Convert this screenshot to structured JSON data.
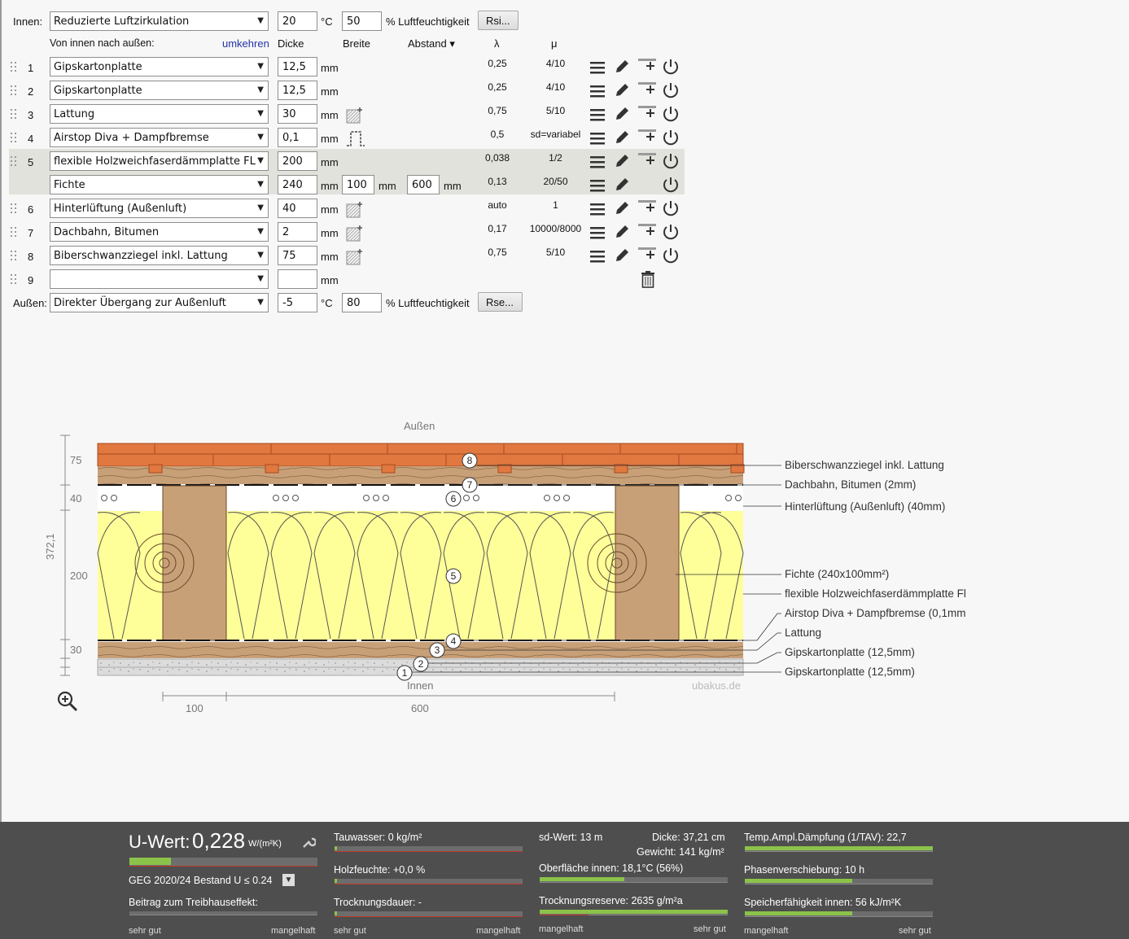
{
  "inside": {
    "label": "Innen:",
    "select": "Reduzierte Luftzirkulation",
    "temp": "20",
    "temp_unit": "°C",
    "humidity": "50",
    "humidity_unit": "% Luftfeuchtigkeit",
    "button": "Rsi..."
  },
  "outside": {
    "label": "Außen:",
    "select": "Direkter Übergang zur Außenluft",
    "temp": "-5",
    "temp_unit": "°C",
    "humidity": "80",
    "humidity_unit": "% Luftfeuchtigkeit",
    "button": "Rse..."
  },
  "headers": {
    "direction": "Von innen nach außen:",
    "reverse": "umkehren",
    "thickness": "Dicke",
    "width": "Breite",
    "spacing": "Abstand ▾",
    "lambda": "λ",
    "mu": "μ"
  },
  "layers": [
    {
      "num": "1",
      "name": "Gipskartonplatte",
      "thickness": "12,5",
      "unit": "mm",
      "lambda": "0,25",
      "mu": "4/10"
    },
    {
      "num": "2",
      "name": "Gipskartonplatte",
      "thickness": "12,5",
      "unit": "mm",
      "lambda": "0,25",
      "mu": "4/10"
    },
    {
      "num": "3",
      "name": "Lattung",
      "thickness": "30",
      "unit": "mm",
      "lambda": "0,75",
      "mu": "5/10"
    },
    {
      "num": "4",
      "name": "Airstop Diva + Dampfbremse",
      "thickness": "0,1",
      "unit": "mm",
      "lambda": "0,5",
      "mu": "sd=variabel"
    },
    {
      "num": "5",
      "name": "flexible Holzweichfaserdämmplatte FL",
      "thickness": "200",
      "unit": "mm",
      "lambda": "0,038",
      "mu": "1/2"
    },
    {
      "num": "",
      "name": "Fichte",
      "thickness": "240",
      "unit": "mm",
      "width": "100",
      "width_unit": "mm",
      "spacing": "600",
      "spacing_unit": "mm",
      "lambda": "0,13",
      "mu": "20/50"
    },
    {
      "num": "6",
      "name": "Hinterlüftung (Außenluft)",
      "thickness": "40",
      "unit": "mm",
      "lambda": "auto",
      "mu": "1"
    },
    {
      "num": "7",
      "name": "Dachbahn, Bitumen",
      "thickness": "2",
      "unit": "mm",
      "lambda": "0,17",
      "mu": "10000/8000"
    },
    {
      "num": "8",
      "name": "Biberschwanzziegel inkl. Lattung",
      "thickness": "75",
      "unit": "mm",
      "lambda": "0,75",
      "mu": "5/10"
    },
    {
      "num": "9",
      "name": "",
      "thickness": "",
      "unit": "mm",
      "lambda": "",
      "mu": ""
    }
  ],
  "diagram": {
    "top_label": "Außen",
    "bottom_label": "Innen",
    "watermark": "ubakus.de",
    "total_thickness": "372,1",
    "dims": [
      "75",
      "40",
      "200",
      "30"
    ],
    "bottom_dims": [
      "100",
      "600"
    ],
    "markers": [
      "1",
      "2",
      "3",
      "4",
      "5",
      "6",
      "7",
      "8"
    ],
    "labels": [
      "Biberschwanzziegel inkl. Lattung",
      "Dachbahn, Bitumen (2mm)",
      "Hinterlüftung (Außenluft) (40mm)",
      "Fichte (240x100mm²)",
      "flexible Holzweichfaserdämmplatte Fl",
      "Airstop Diva + Dampfbremse (0,1mm",
      "Lattung",
      "Gipskartonplatte (12,5mm)",
      "Gipskartonplatte (12,5mm)"
    ]
  },
  "results": {
    "uwert_label": "U-Wert:",
    "uwert_value": "0,228",
    "uwert_unit": "W/(m²K)",
    "geg": "GEG 2020/24 Bestand U ≤ 0.24",
    "treibhaus": "Beitrag zum Treibhauseffekt:",
    "tauwasser": "Tauwasser: 0 kg/m²",
    "holzfeuchte": "Holzfeuchte: +0,0 %",
    "trocknungsdauer": "Trocknungsdauer: -",
    "sdwert": "sd-Wert: 13 m",
    "dicke": "Dicke: 37,21 cm",
    "gewicht": "Gewicht: 141 kg/m²",
    "oberflaeche": "Oberfläche innen: 18,1°C (56%)",
    "trocknungsreserve": "Trocknungsreserve: 2635 g/m²a",
    "tav": "Temp.Ampl.Dämpfung (1/TAV): 22,7",
    "phase": "Phasenverschiebung: 10 h",
    "speicher": "Speicherfähigkeit innen: 56 kJ/m²K",
    "scale_good": "sehr gut",
    "scale_bad": "mangelhaft"
  },
  "bars": {
    "uwert": 0.22,
    "oberflaeche": 0.45,
    "trocknungsreserve": 1.0,
    "tav": 1.0,
    "phase": 0.57,
    "speicher": 0.57
  },
  "colors": {
    "accent": "#8bc34a",
    "insulation": "#ffff99",
    "timber": "#c8a078",
    "tile": "#e07840",
    "panel": "#4e4e4e"
  }
}
